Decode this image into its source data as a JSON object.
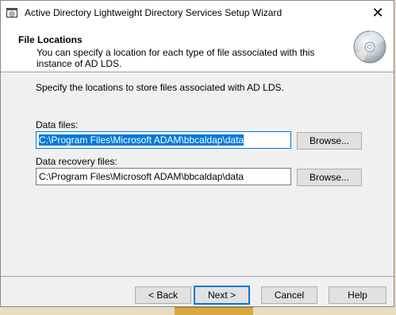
{
  "window": {
    "title": "Active Directory Lightweight Directory Services Setup Wizard",
    "close_glyph": "✕"
  },
  "header": {
    "title": "File Locations",
    "subtitle": "You can specify a location for each type of file associated with this instance of AD LDS.",
    "icon": "cd-disc-icon"
  },
  "content": {
    "intro": "Specify the locations to store files associated with AD LDS.",
    "data_files": {
      "label": "Data files:",
      "value": "C:\\Program Files\\Microsoft ADAM\\bbcaldap\\data",
      "browse_label": "Browse..."
    },
    "recovery_files": {
      "label": "Data recovery files:",
      "value": "C:\\Program Files\\Microsoft ADAM\\bbcaldap\\data",
      "browse_label": "Browse..."
    }
  },
  "footer": {
    "back_label": "< Back",
    "next_label": "Next >",
    "cancel_label": "Cancel",
    "help_label": "Help"
  },
  "colors": {
    "accent": "#0078d7",
    "window_bg": "#f0f0f0",
    "header_bg": "#ffffff"
  }
}
